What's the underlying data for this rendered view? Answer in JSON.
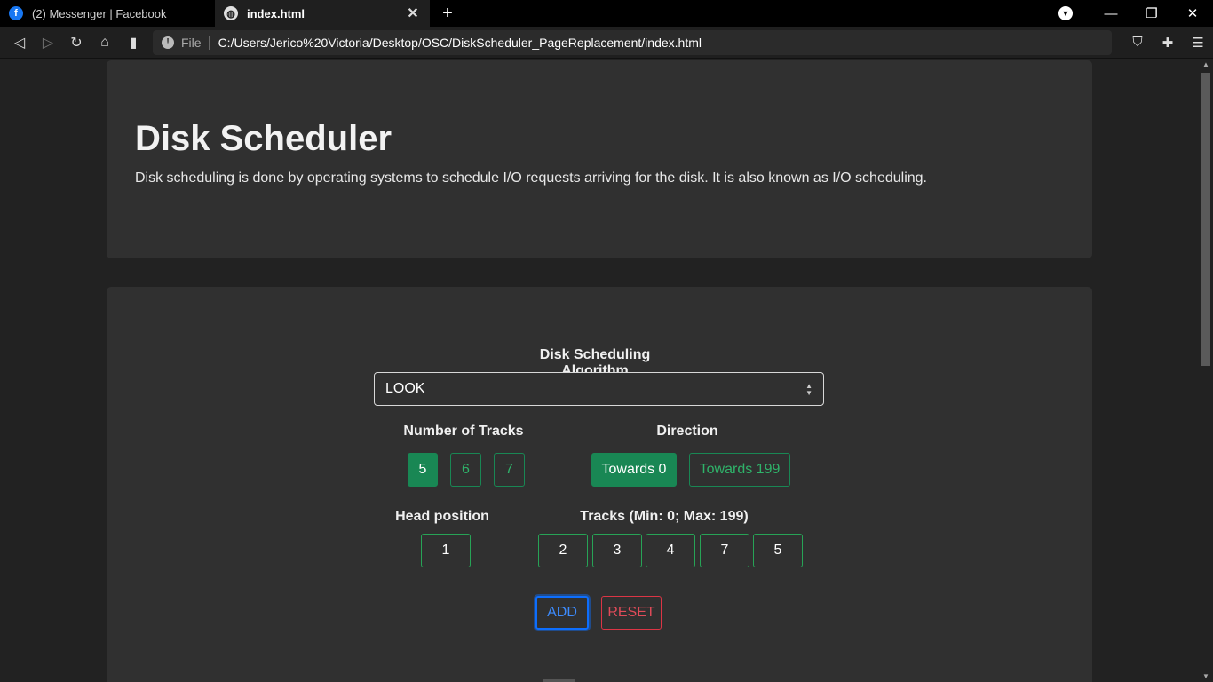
{
  "browser": {
    "tabs": [
      {
        "title": "(2) Messenger | Facebook",
        "icon": "facebook-icon"
      },
      {
        "title": "index.html",
        "icon": "globe-icon"
      }
    ],
    "file_label": "File",
    "url": "C:/Users/Jerico%20Victoria/Desktop/OSC/DiskScheduler_PageReplacement/index.html"
  },
  "header": {
    "title": "Disk Scheduler",
    "description": "Disk scheduling is done by operating systems to schedule I/O requests arriving for the disk. It is also known as I/O scheduling."
  },
  "form": {
    "algorithm_label": "Disk Scheduling Algorithm",
    "algorithm_selected": "LOOK",
    "tracks_label": "Number of Tracks",
    "track_counts": [
      "5",
      "6",
      "7"
    ],
    "direction_label": "Direction",
    "directions": [
      "Towards 0",
      "Towards 199"
    ],
    "head_label": "Head position",
    "head_value": "1",
    "tracks_input_label": "Tracks (Min: 0; Max: 199)",
    "track_values": [
      "2",
      "3",
      "4",
      "7",
      "5"
    ],
    "add_label": "ADD",
    "reset_label": "RESET"
  },
  "colors": {
    "success": "#198754",
    "primary": "#0d6efd",
    "danger": "#dc3545"
  }
}
